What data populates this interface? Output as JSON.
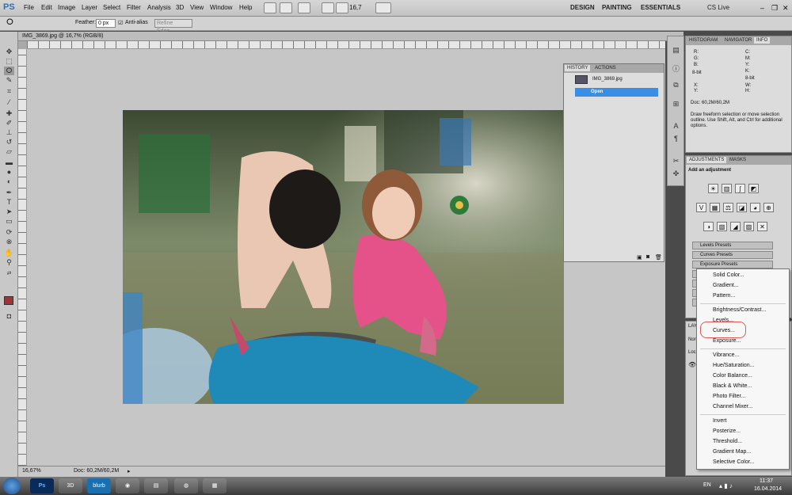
{
  "app": {
    "logo": "PS"
  },
  "menu": [
    "File",
    "Edit",
    "Image",
    "Layer",
    "Select",
    "Filter",
    "Analysis",
    "3D",
    "View",
    "Window",
    "Help"
  ],
  "zoom_value": "16,7",
  "workspaces": [
    "DESIGN",
    "PAINTING",
    "ESSENTIALS"
  ],
  "cslive": "CS Live",
  "options": {
    "feather_label": "Feather:",
    "feather_value": "0 px",
    "antialias": "Anti-alias",
    "refine_edge": "Refine Edge..."
  },
  "document": {
    "tab_title": "IMG_3869.jpg @ 16,7% (RGB/8)",
    "zoom_status": "16,67%",
    "doc_status": "Doc: 60,2M/60,2M"
  },
  "history": {
    "tabs": [
      "HISTORY",
      "ACTIONS"
    ],
    "snapshot": "IMG_3869.jpg",
    "item": "Open"
  },
  "info": {
    "tabs": [
      "HISTOGRAM",
      "NAVIGATOR",
      "INFO"
    ],
    "r": "R:",
    "g": "G:",
    "b": "B:",
    "bit1": "8-bit",
    "c": "C:",
    "m": "M:",
    "y": "Y:",
    "k": "K:",
    "bit2": "8-bit",
    "x": "X:",
    "yv": "Y:",
    "w": "W:",
    "h": "H:",
    "doc": "Doc: 60,2M/60,2M",
    "hint": "Draw freeform selection or move selection outline.  Use Shift, Alt, and Ctrl for additional options."
  },
  "adjustments": {
    "tabs": [
      "ADJUSTMENTS",
      "MASKS"
    ],
    "title": "Add an adjustment",
    "presets": [
      "Levels Presets",
      "Curves Presets",
      "Exposure Presets"
    ]
  },
  "layers": {
    "tab": "LAY",
    "blend": "Nor",
    "lock": "Loc"
  },
  "dropdown": {
    "group1": [
      "Solid Color...",
      "Gradient...",
      "Pattern..."
    ],
    "group2": [
      "Brightness/Contrast...",
      "Levels...",
      "Curves...",
      "Exposure..."
    ],
    "group3": [
      "Vibrance...",
      "Hue/Saturation...",
      "Color Balance...",
      "Black & White...",
      "Photo Filter...",
      "Channel Mixer..."
    ],
    "group4": [
      "Invert",
      "Posterize...",
      "Threshold...",
      "Gradient Map...",
      "Selective Color..."
    ]
  },
  "taskbar": {
    "lang": "EN",
    "time": "11:37",
    "date": "16.04.2014",
    "apps": [
      "Ps",
      "3D",
      "blurb",
      "",
      "",
      "",
      "",
      ""
    ]
  },
  "colors": {
    "foreground": "#a0323a",
    "selection": "#3a8ee6",
    "highlight_ring": "#e05a5a"
  }
}
